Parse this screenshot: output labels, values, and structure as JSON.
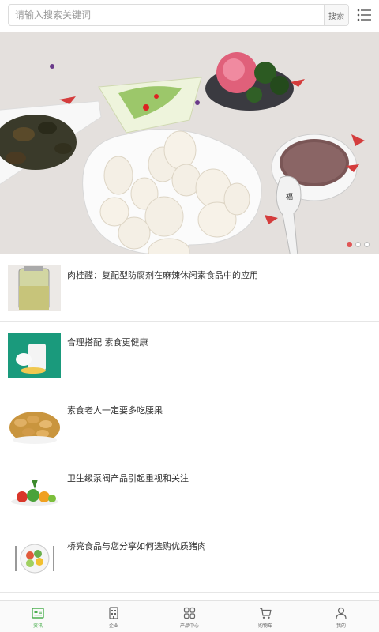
{
  "search": {
    "placeholder": "请输入搜索关键词",
    "button_label": "搜索"
  },
  "banner": {
    "slides": 3,
    "active_slide": 1
  },
  "news": [
    {
      "title": "肉桂醛：复配型防腐剂在麻辣休闲素食品中的应用"
    },
    {
      "title": "合理搭配 素食更健康"
    },
    {
      "title": "素食老人一定要多吃腰果"
    },
    {
      "title": "卫生级泵阀产品引起重视和关注"
    },
    {
      "title": "桥亮食品与您分享如何选购优质猪肉"
    }
  ],
  "nav": [
    {
      "label": "资讯",
      "icon": "news-icon",
      "active": true
    },
    {
      "label": "企业",
      "icon": "company-icon",
      "active": false
    },
    {
      "label": "产品中心",
      "icon": "grid-icon",
      "active": false
    },
    {
      "label": "购物车",
      "icon": "cart-icon",
      "active": false
    },
    {
      "label": "我的",
      "icon": "user-icon",
      "active": false
    }
  ],
  "colors": {
    "accent": "#4caf50",
    "dot_active": "#e05555"
  }
}
